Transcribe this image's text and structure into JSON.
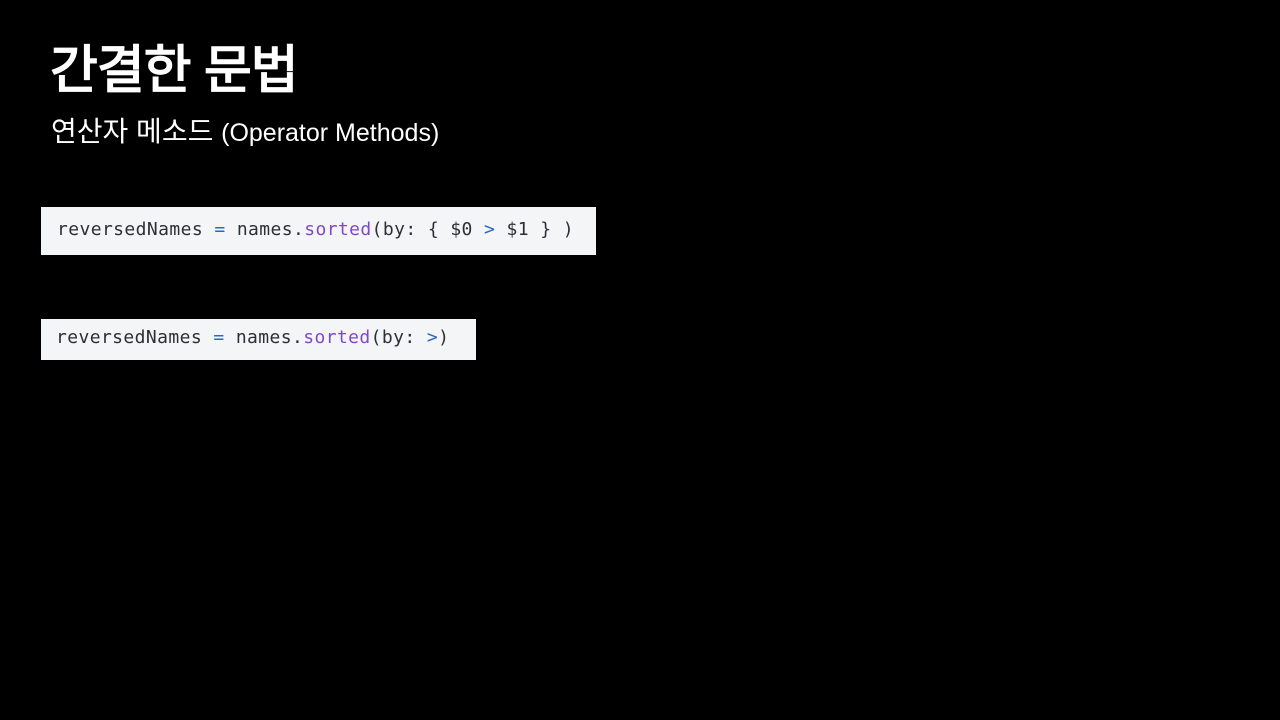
{
  "slide": {
    "title": "간결한 문법",
    "subtitle_ko": "연산자 메소드 ",
    "subtitle_en": "(Operator Methods)"
  },
  "code1": {
    "var": "reversedNames",
    "assign": " = ",
    "obj": "names.",
    "fn": "sorted",
    "args_pre": "(by: { $0 ",
    "op": ">",
    "args_post": " $1 } )"
  },
  "code2": {
    "var": "reversedNames",
    "assign": " = ",
    "obj": "names.",
    "fn": "sorted",
    "args_pre": "(by: ",
    "op": ">",
    "args_post": ")"
  },
  "colors": {
    "background": "#000000",
    "code_background": "#f4f5f7",
    "code_text": "#2b2f36",
    "keyword_function": "#8049c8",
    "operator": "#2a66c6"
  }
}
